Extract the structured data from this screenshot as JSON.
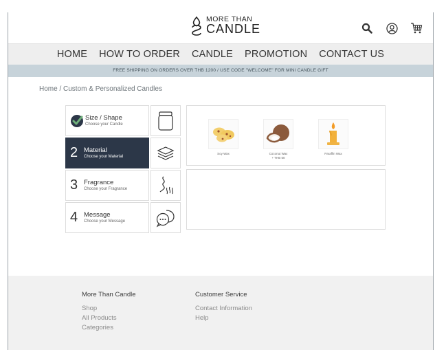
{
  "brand": {
    "logo_top": "MORE THAN",
    "logo_bottom": "CANDLE"
  },
  "header_icons": [
    "search-icon",
    "account-icon",
    "cart-icon"
  ],
  "nav": [
    "HOME",
    "HOW TO ORDER",
    "CANDLE",
    "PROMOTION",
    "CONTACT US"
  ],
  "promo": "FREE SHIPPING ON ORDERS OVER THB 1200 / USE CODE \"WELCOME\" FOR MINI CANDLE GIFT",
  "breadcrumb": "Home / Custom & Personalized Candles",
  "steps": [
    {
      "num": "",
      "title": "Size / Shape",
      "sub": "Choose your Candle",
      "done": true,
      "icon": "jar-icon"
    },
    {
      "num": "2",
      "title": "Material",
      "sub": "Choose your Material",
      "active": true,
      "icon": "layers-icon"
    },
    {
      "num": "3",
      "title": "Fragrance",
      "sub": "Choose your Fragrance",
      "icon": "scent-icon"
    },
    {
      "num": "4",
      "title": "Message",
      "sub": "Choose your Message",
      "icon": "message-icon"
    }
  ],
  "materials": [
    {
      "label": "Soy Wax",
      "icon": "soy-icon"
    },
    {
      "label": "Coconut Wax",
      "label2": "+ THB 50",
      "icon": "coconut-icon"
    },
    {
      "label": "Paraffin Wax",
      "icon": "paraffin-icon"
    }
  ],
  "footer": {
    "col1": {
      "heading": "More Than Candle",
      "links": [
        "Shop",
        "All Products",
        "Categories"
      ]
    },
    "col2": {
      "heading": "Customer Service",
      "links": [
        "Contact Information",
        "Help"
      ]
    }
  },
  "colors": {
    "active_step": "#2c3748",
    "nav_bg": "#eeeeee",
    "promo_bg": "#c7d3da",
    "footer_bg": "#f1f1f1",
    "check": "#5aa36a"
  }
}
